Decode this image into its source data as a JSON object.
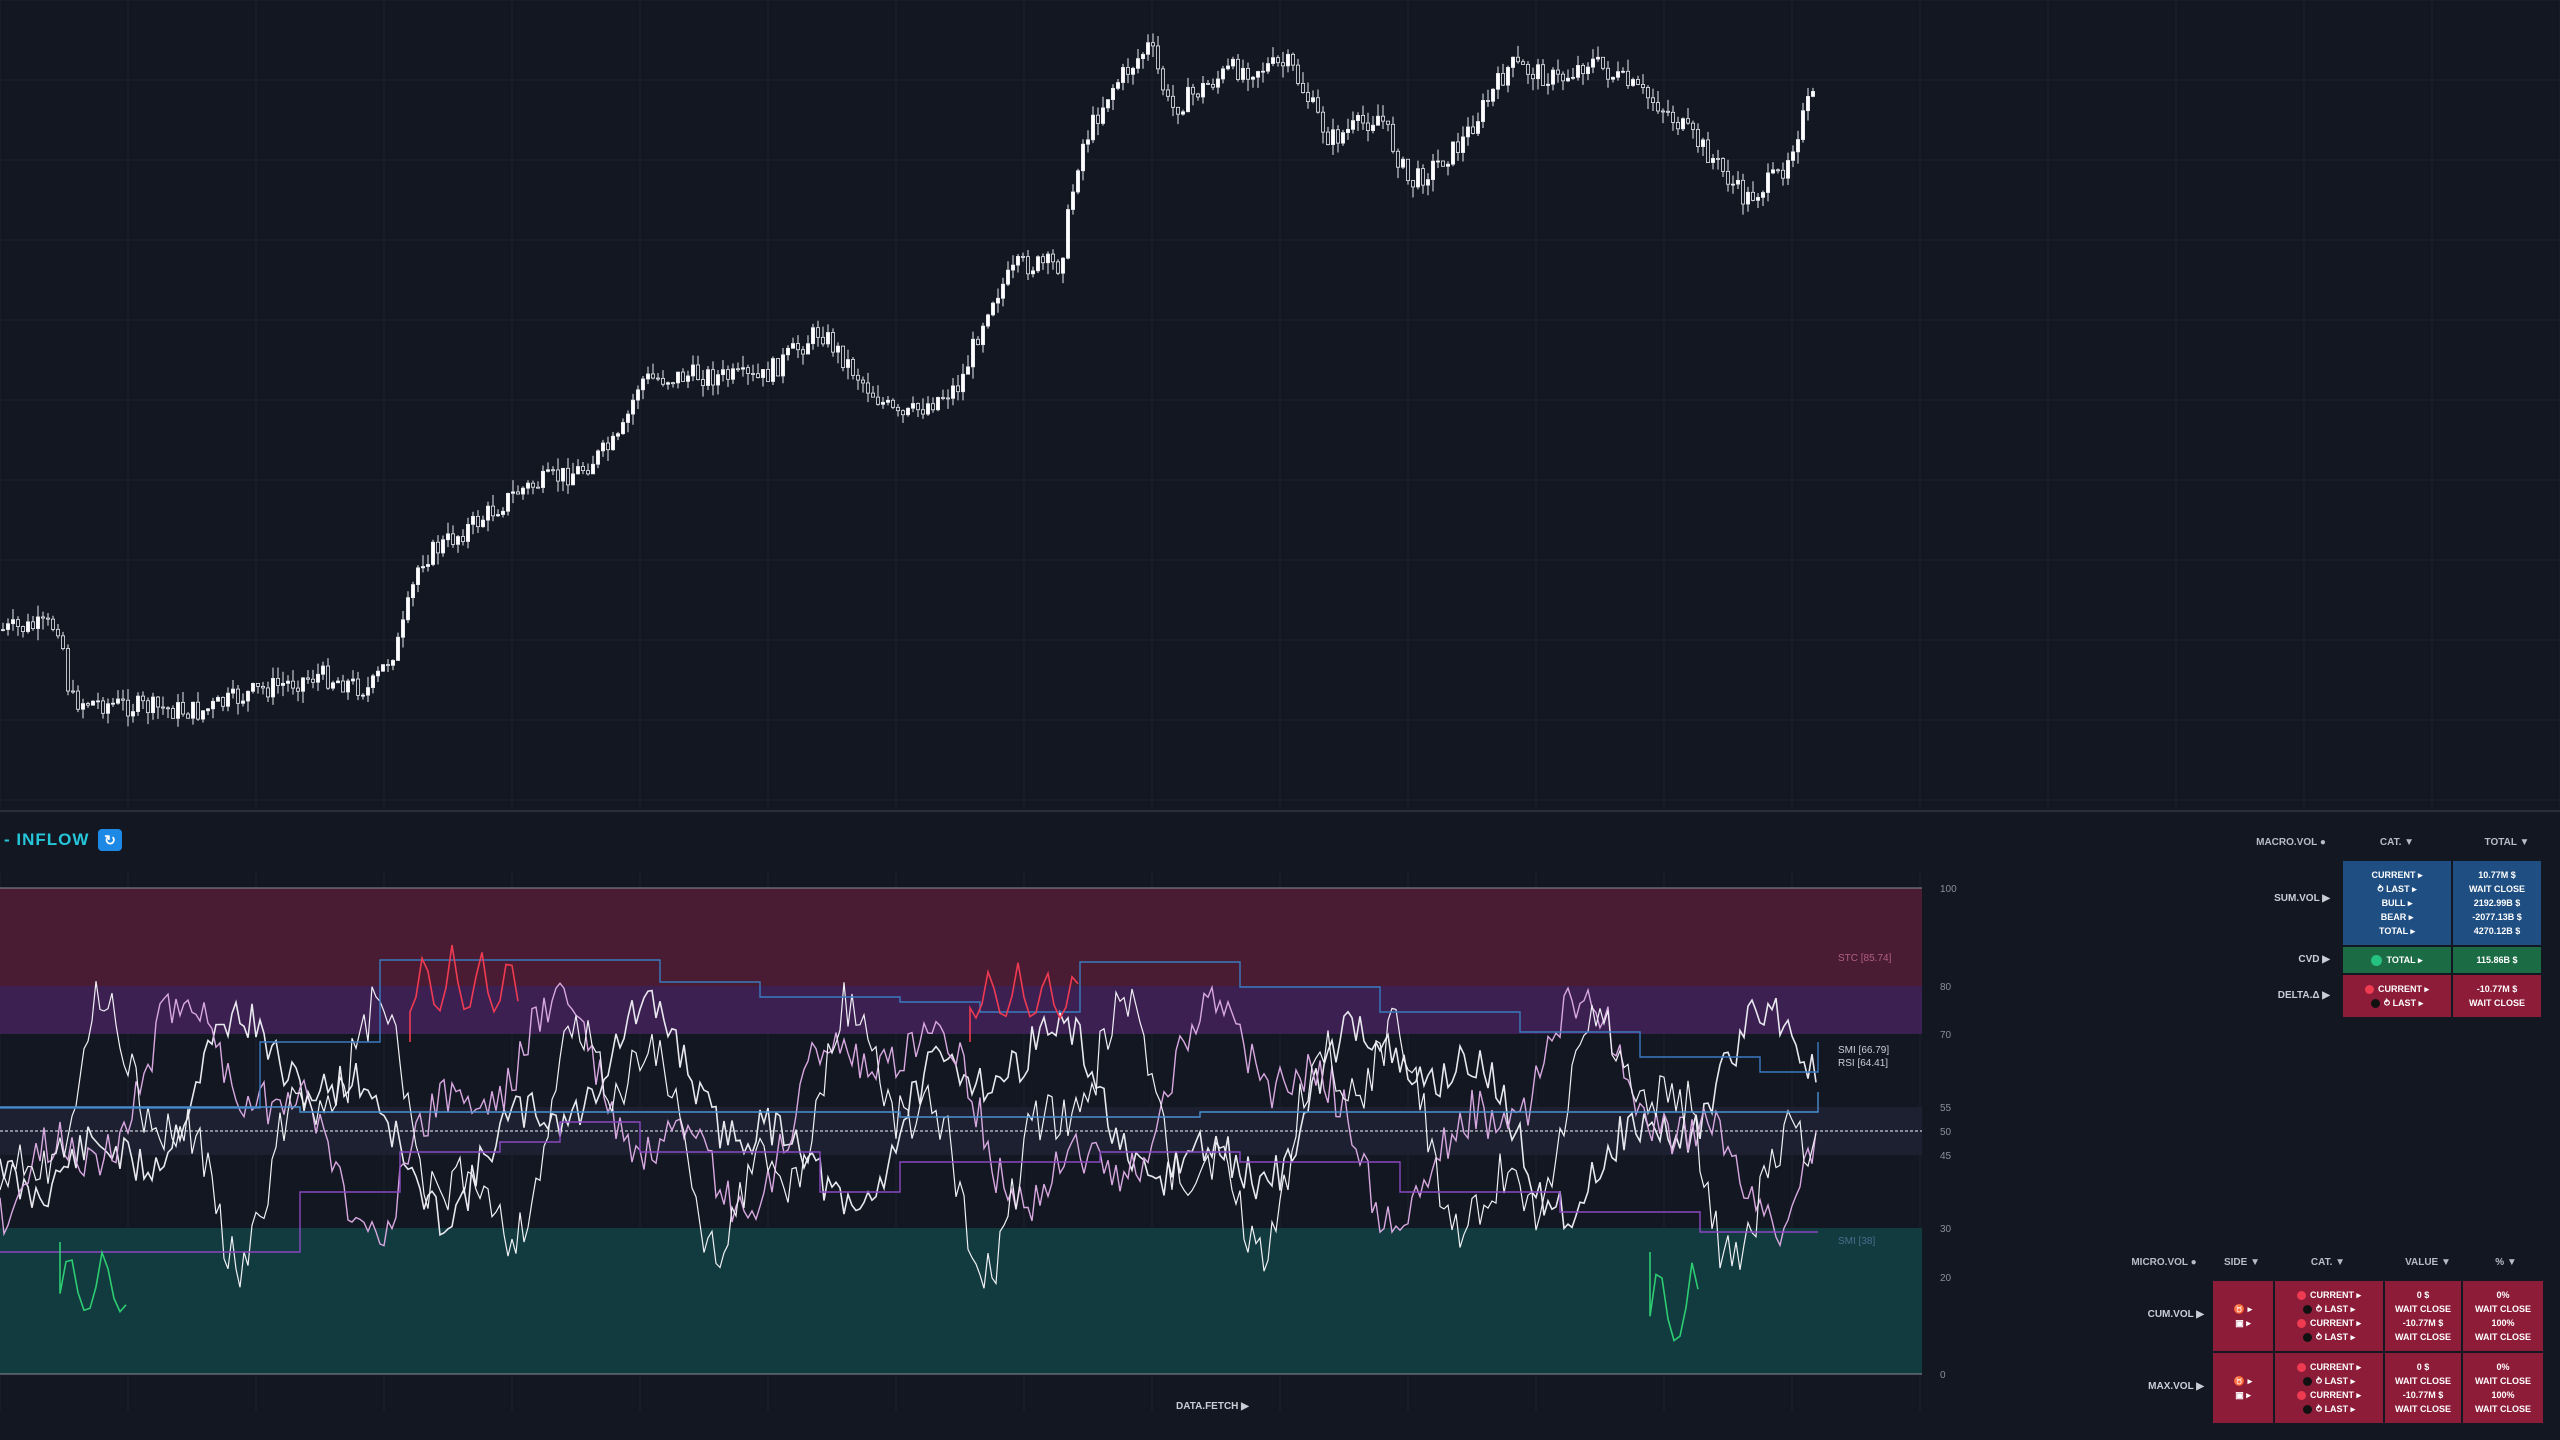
{
  "indicator": {
    "title": "- INFLOW",
    "badge_icon": "refresh-icon"
  },
  "levels": [
    "100",
    "80",
    "70",
    "55",
    "50",
    "45",
    "30",
    "20",
    "0"
  ],
  "line_labels": {
    "stc": "STC [85.74]",
    "smi": "SMI [66.79]",
    "rsi": "RSI [64.41]",
    "lower": "SMI [38]"
  },
  "colors": {
    "overbought": "#4a1c33",
    "upper_band": "#3d2052",
    "oversold": "#113b3f",
    "bull": "#26a69a",
    "bear": "#ef5350",
    "table_blue": "#1f4e82",
    "table_green": "#1b6b45",
    "table_red": "#8c1c38"
  },
  "macro_table": {
    "headers": {
      "title": "MACRO.VOL",
      "cat": "CAT.",
      "total": "TOTAL"
    },
    "sum_vol": {
      "label": "SUM.VOL",
      "cat_lines": [
        "CURRENT",
        "LAST",
        "BULL",
        "BEAR",
        "TOTAL"
      ],
      "values": [
        "10.77M $",
        "WAIT CLOSE",
        "2192.99B $",
        "-2077.13B $",
        "4270.12B $"
      ]
    },
    "cvd": {
      "label": "CVD",
      "cat": "TOTAL",
      "value": "115.86B $"
    },
    "delta": {
      "label": "DELTA.Δ",
      "cat_lines": [
        "CURRENT",
        "LAST"
      ],
      "values": [
        "-10.77M $",
        "WAIT CLOSE"
      ]
    }
  },
  "micro_table": {
    "headers": {
      "title": "MICRO.VOL",
      "side": "SIDE",
      "cat": "CAT.",
      "value": "VALUE",
      "pct": "%"
    },
    "cum_vol": {
      "label": "CUM.VOL",
      "cat_lines": [
        "CURRENT",
        "LAST",
        "CURRENT",
        "LAST"
      ],
      "values": [
        "0 $",
        "WAIT CLOSE",
        "-10.77M $",
        "WAIT CLOSE"
      ],
      "pcts": [
        "0%",
        "WAIT CLOSE",
        "100%",
        "WAIT CLOSE"
      ]
    },
    "max_vol": {
      "label": "MAX.VOL",
      "cat_lines": [
        "CURRENT",
        "LAST",
        "CURRENT",
        "LAST"
      ],
      "values": [
        "0 $",
        "WAIT CLOSE",
        "-10.77M $",
        "WAIT CLOSE"
      ],
      "pcts": [
        "0%",
        "WAIT CLOSE",
        "100%",
        "WAIT CLOSE"
      ]
    }
  },
  "footer": {
    "data_fetch": "DATA.FETCH"
  }
}
